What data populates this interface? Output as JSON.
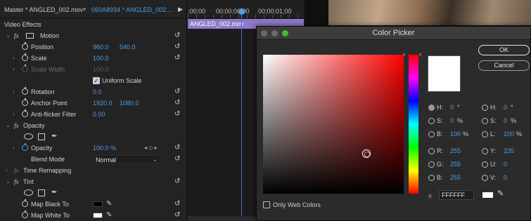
{
  "effect_controls": {
    "master_label": "Master * ANGLED_002.mov",
    "clip_label": "060A8934 * ANGLED_002....",
    "section_title": "Video Effects",
    "motion": {
      "title": "Motion",
      "position": {
        "label": "Position",
        "x": "960.0",
        "y": "540.0"
      },
      "scale": {
        "label": "Scale",
        "value": "100.0"
      },
      "scale_width": {
        "label": "Scale Width",
        "value": "100.0"
      },
      "uniform_scale": {
        "label": "Uniform Scale",
        "checked": true
      },
      "rotation": {
        "label": "Rotation",
        "value": "0.0"
      },
      "anchor_point": {
        "label": "Anchor Point",
        "x": "1920.0",
        "y": "1080.0"
      },
      "anti_flicker": {
        "label": "Anti-flicker Filter",
        "value": "0.00"
      }
    },
    "opacity": {
      "title": "Opacity",
      "opacity": {
        "label": "Opacity",
        "value": "100.0 %"
      },
      "blend_mode": {
        "label": "Blend Mode",
        "value": "Normal"
      }
    },
    "time_remapping": {
      "title": "Time Remapping"
    },
    "tint": {
      "title": "Tint",
      "map_black": {
        "label": "Map Black To",
        "color": "#000000"
      },
      "map_white": {
        "label": "Map White To",
        "color": "#ffffff"
      }
    }
  },
  "timeline": {
    "timecodes": [
      ";00;00",
      "00;00;00;00",
      "00;00;01;00"
    ],
    "clip_name": "ANGLED_002.mov"
  },
  "color_picker": {
    "title": "Color Picker",
    "ok_label": "OK",
    "cancel_label": "Cancel",
    "hsb": [
      {
        "label": "H:",
        "value": "0",
        "unit": "°",
        "checked": true
      },
      {
        "label": "S:",
        "value": "0",
        "unit": "%",
        "checked": false
      },
      {
        "label": "B:",
        "value": "100",
        "unit": "%",
        "checked": false
      }
    ],
    "hsl": [
      {
        "label": "H:",
        "value": "0",
        "unit": "°"
      },
      {
        "label": "S:",
        "value": "0",
        "unit": "%"
      },
      {
        "label": "L:",
        "value": "100",
        "unit": "%"
      }
    ],
    "rgb": [
      {
        "label": "R:",
        "value": "255"
      },
      {
        "label": "G:",
        "value": "255"
      },
      {
        "label": "B:",
        "value": "255"
      }
    ],
    "yuv": [
      {
        "label": "Y:",
        "value": "235"
      },
      {
        "label": "U:",
        "value": "0"
      },
      {
        "label": "V:",
        "value": "0"
      }
    ],
    "hex_prefix": "#",
    "hex_value": "FFFFFF",
    "current_color": "#ffffff",
    "only_web_colors_label": "Only Web Colors"
  },
  "colors": {
    "accent_blue": "#4d9ee8",
    "clip_purple": "#8e78c8",
    "mac_green": "#3bbf3b"
  }
}
